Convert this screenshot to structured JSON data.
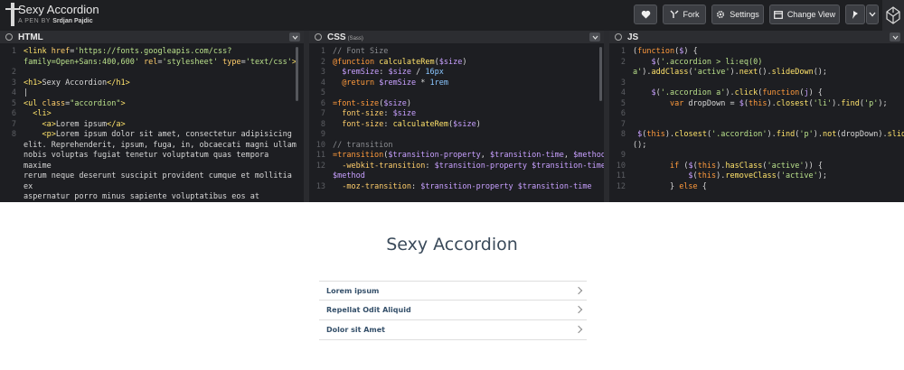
{
  "pen": {
    "title": "Sexy Accordion",
    "by_prefix": "A PEN BY",
    "author": "Srdjan Pajdic"
  },
  "toolbar": {
    "heart_icon": "heart-icon",
    "fork_label": "Fork",
    "settings_label": "Settings",
    "change_view_label": "Change View"
  },
  "editors": {
    "html": {
      "label": "HTML"
    },
    "css": {
      "label": "CSS",
      "sub": "(Sass)"
    },
    "js": {
      "label": "JS"
    }
  },
  "preview": {
    "heading": "Sexy Accordion",
    "items": [
      "Lorem ipsum",
      "Repellat Odit Aliquid",
      "Dolor sit Amet"
    ]
  },
  "colors": {
    "topbar": "#1e1f22",
    "editor_bg": "#1d1e22",
    "accordion_text": "#35506a",
    "heading_text": "#3a4a5a"
  }
}
